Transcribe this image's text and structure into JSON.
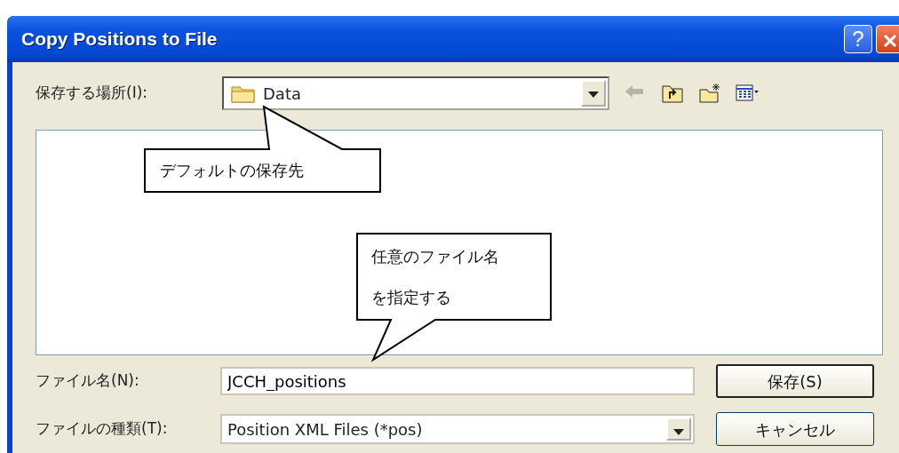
{
  "window": {
    "title": "Copy Positions to File",
    "buttons": [
      {
        "kind": "help",
        "label": "?"
      },
      {
        "kind": "close"
      }
    ]
  },
  "save_in": {
    "label": "保存する場所(I):",
    "value": "Data"
  },
  "toolbar": [
    {
      "kind": "back",
      "disabled": true
    },
    {
      "kind": "up",
      "disabled": false
    },
    {
      "kind": "new_folder",
      "disabled": false
    },
    {
      "kind": "view",
      "disabled": false
    }
  ],
  "file_name": {
    "label": "ファイル名(N):",
    "value": "JCCH_positions"
  },
  "file_type": {
    "label": "ファイルの種類(T):",
    "value": "Position XML Files (*pos)"
  },
  "buttons": [
    {
      "label": "保存(S)",
      "default": true
    },
    {
      "label": "キャンセル",
      "default": false
    }
  ],
  "callouts": [
    {
      "text": "デフォルトの保存先"
    },
    {
      "text": "任意のファイル名を指定する"
    }
  ]
}
